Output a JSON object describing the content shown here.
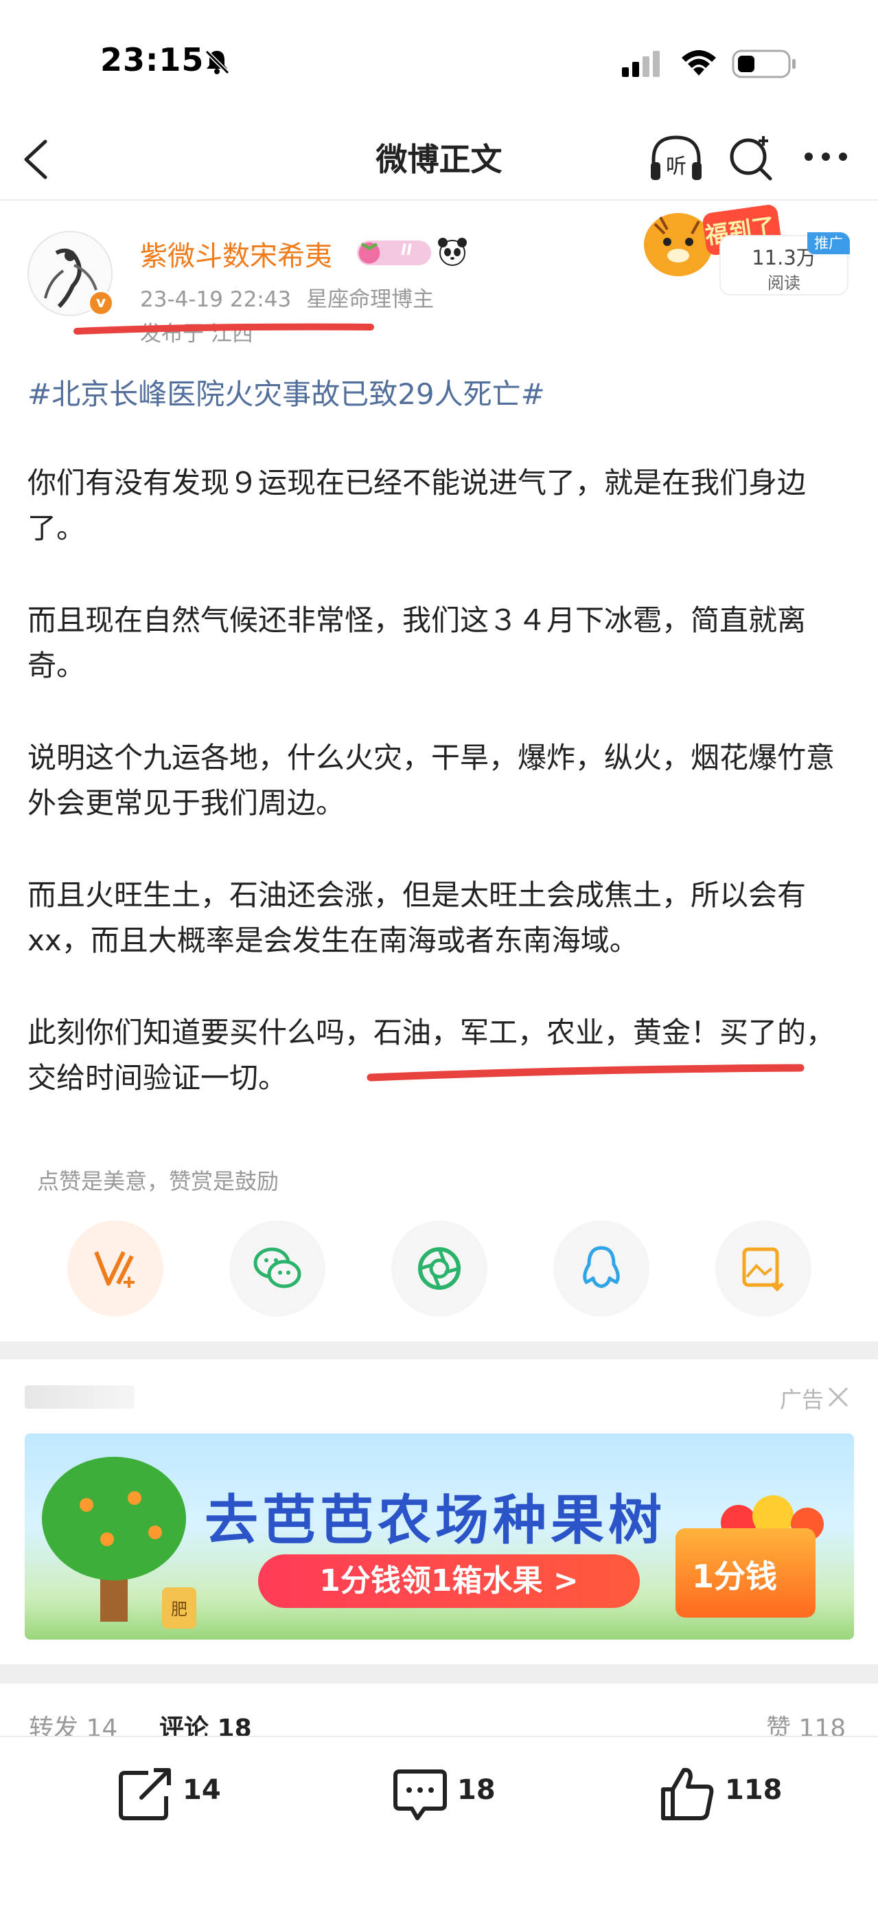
{
  "status_bar": {
    "time": "23:15"
  },
  "nav": {
    "title": "微博正文",
    "listen_label": "听"
  },
  "post": {
    "author": "紫微斗数宋希夷",
    "vip_level": "II",
    "date": "23-4-19 22:43",
    "author_desc": "星座命理博主",
    "location": "发布于 江西",
    "reads": "11.3万",
    "reads_label": "阅读",
    "promo_tag": "推广",
    "topic": "#北京长峰医院火灾事故已致29人死亡#",
    "paragraphs": [
      "你们有没有发现９运现在已经不能说进气了，就是在我们身边了。",
      "而且现在自然气候还非常怪，我们这３４月下冰雹，简直就离奇。",
      "说明这个九运各地，什么火灾，干旱，爆炸，纵火，烟花爆竹意外会更常见于我们周边。",
      "而且火旺生土，石油还会涨，但是太旺土会成焦土，所以会有xx，而且大概率是会发生在南海或者东南海域。",
      "此刻你们知道要买什么吗，石油，军工，农业，黄金！买了的，交给时间验证一切。"
    ],
    "tip_hint": "点赞是美意，赞赏是鼓励"
  },
  "share": {
    "items": [
      "tip-icon",
      "wechat-icon",
      "moments-icon",
      "qq-icon",
      "save-image-icon"
    ]
  },
  "ad": {
    "label": "广告",
    "title": "去芭芭农场种果树",
    "pill": "1分钱领1箱水果 >",
    "price": "1分钱",
    "fertilizer": "肥"
  },
  "counts": {
    "reposts_label": "转发 14",
    "comments_label": "评论 18",
    "likes_label": "赞 118"
  },
  "toolbar": {
    "repost_count": "14",
    "comment_count": "18",
    "like_count": "118"
  },
  "colors": {
    "accent_orange": "#f07b1a",
    "topic_blue": "#526f9c",
    "annotation_red": "#e8423f"
  }
}
